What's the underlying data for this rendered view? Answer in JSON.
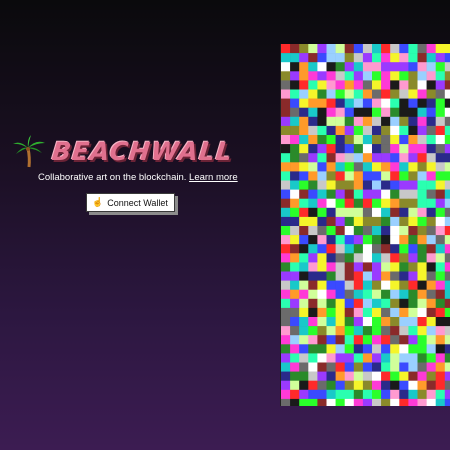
{
  "brand": {
    "name": "BEACHWALL",
    "icon": "palm-tree-icon",
    "title_color": "#e0708e"
  },
  "hero": {
    "tagline": "Collaborative art on the blockchain.",
    "learn_more": "Learn more"
  },
  "wallet": {
    "connect_label": "Connect Wallet",
    "icon": "pointing-hand-icon"
  },
  "canvas": {
    "palette": [
      "#ff2a2a",
      "#2aff2a",
      "#3a4aff",
      "#ff3ad6",
      "#19c9c9",
      "#f5f52a",
      "#ff9a2a",
      "#9a3aff",
      "#ffffff",
      "#c8c8c8",
      "#6b6b6b",
      "#1a1a1a",
      "#2a8a2a",
      "#8a2a2a",
      "#ff9ad0",
      "#9ad0ff",
      "#d0ff9a",
      "#2a2a8a",
      "#8a8a2a",
      "#2affb0"
    ]
  }
}
